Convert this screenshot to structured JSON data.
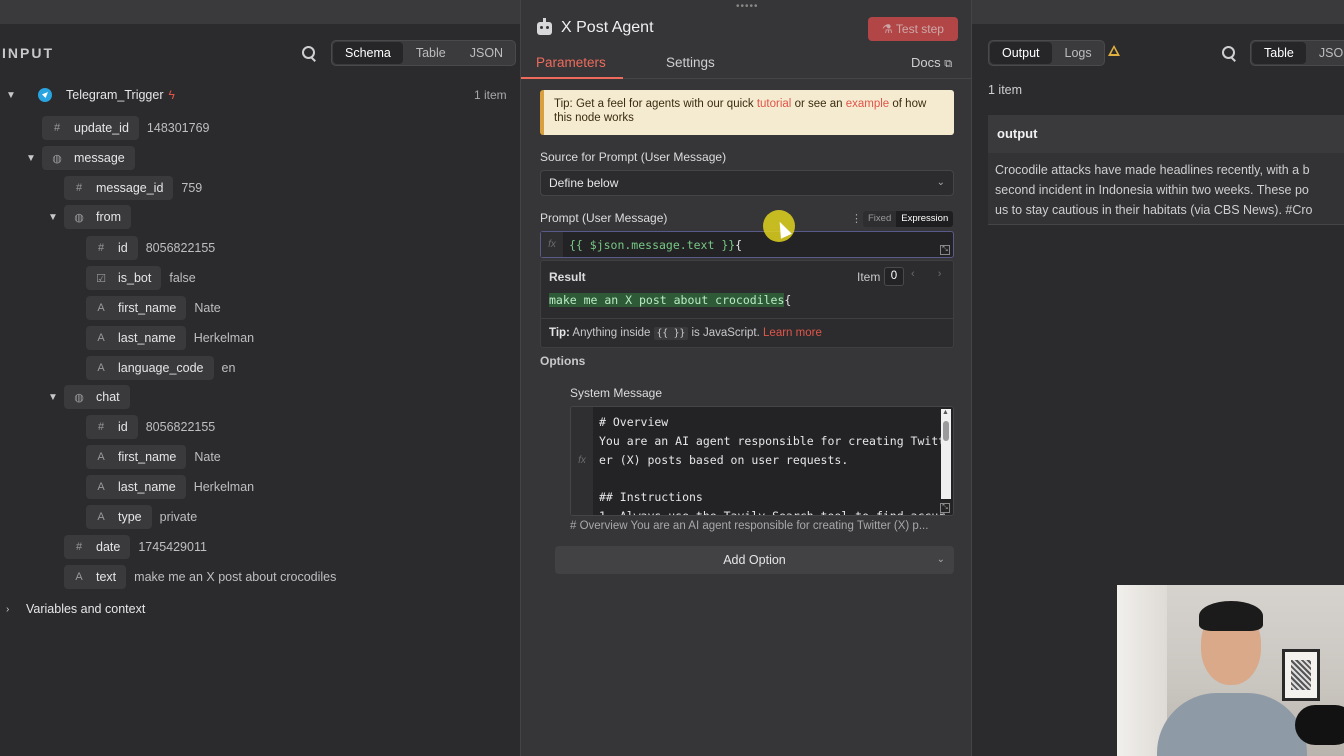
{
  "input": {
    "title": "INPUT",
    "views": [
      "Schema",
      "Table",
      "JSON"
    ],
    "trigger": {
      "name": "Telegram_Trigger",
      "count": "1 item"
    },
    "fields": {
      "update_id": {
        "key": "update_id",
        "value": "148301769"
      },
      "message": {
        "key": "message"
      },
      "message_id": {
        "key": "message_id",
        "value": "759"
      },
      "from": {
        "key": "from"
      },
      "from_id": {
        "key": "id",
        "value": "8056822155"
      },
      "is_bot": {
        "key": "is_bot",
        "value": "false"
      },
      "from_first_name": {
        "key": "first_name",
        "value": "Nate"
      },
      "from_last_name": {
        "key": "last_name",
        "value": "Herkelman"
      },
      "language_code": {
        "key": "language_code",
        "value": "en"
      },
      "chat": {
        "key": "chat"
      },
      "chat_id": {
        "key": "id",
        "value": "8056822155"
      },
      "chat_first_name": {
        "key": "first_name",
        "value": "Nate"
      },
      "chat_last_name": {
        "key": "last_name",
        "value": "Herkelman"
      },
      "type": {
        "key": "type",
        "value": "private"
      },
      "date": {
        "key": "date",
        "value": "1745429011"
      },
      "text": {
        "key": "text",
        "value": "make me an X post about crocodiles"
      }
    },
    "variables_label": "Variables and context"
  },
  "node": {
    "grip": "•••••",
    "title": "X Post Agent",
    "test_step": "Test step",
    "tabs": {
      "parameters": "Parameters",
      "settings": "Settings",
      "docs": "Docs"
    },
    "tip": {
      "prefix": "Tip: Get a feel for agents with our quick ",
      "tutorial": "tutorial",
      "middle": " or see an ",
      "example": "example",
      "suffix": " of how this node works"
    },
    "source_label": "Source for Prompt (User Message)",
    "source_value": "Define below",
    "prompt_label": "Prompt (User Message)",
    "mode_fixed": "Fixed",
    "mode_expression": "Expression",
    "expression_code": "{{ $json.message.text }}",
    "expression_trail": "{",
    "result_label": "Result",
    "item_label": "Item",
    "item_index": "0",
    "result_text": "make me an X post about crocodiles",
    "result_trail": "{",
    "expr_tip_bold": "Tip:",
    "expr_tip_text": " Anything inside ",
    "expr_tip_chip": "{{ }}",
    "expr_tip_text2": " is JavaScript. ",
    "expr_tip_link": "Learn more",
    "options_label": "Options",
    "system_message_label": "System Message",
    "system_message_code": "# Overview\nYou are an AI agent responsible for creating Twitt\ner (X) posts based on user requests.\n\n## Instructions\n1. Always use the Tavily Search tool to find accur",
    "system_message_preview": "# Overview   You are an AI agent responsible for creating Twitter (X) p...",
    "add_option": "Add Option"
  },
  "output": {
    "tabs": [
      "Output",
      "Logs"
    ],
    "views": [
      "Table",
      "JSON"
    ],
    "count": "1 item",
    "header": "output",
    "body_lines": [
      "Crocodile attacks have made headlines recently, with a b",
      "second incident in Indonesia within two weeks. These po",
      "us to stay cautious in their habitats (via CBS News). #Cro"
    ]
  },
  "colors": {
    "accent": "#ee6b5c",
    "test_button": "#d24a4a",
    "telegram": "#2aa4e0",
    "warning": "#e0b040"
  },
  "icons": [
    "search-icon",
    "telegram-icon",
    "bolt-icon",
    "robot-icon",
    "flask-icon",
    "external-link-icon",
    "chevron-down-icon",
    "kebab-icon",
    "fx-icon",
    "resize-icon",
    "warning-icon"
  ]
}
